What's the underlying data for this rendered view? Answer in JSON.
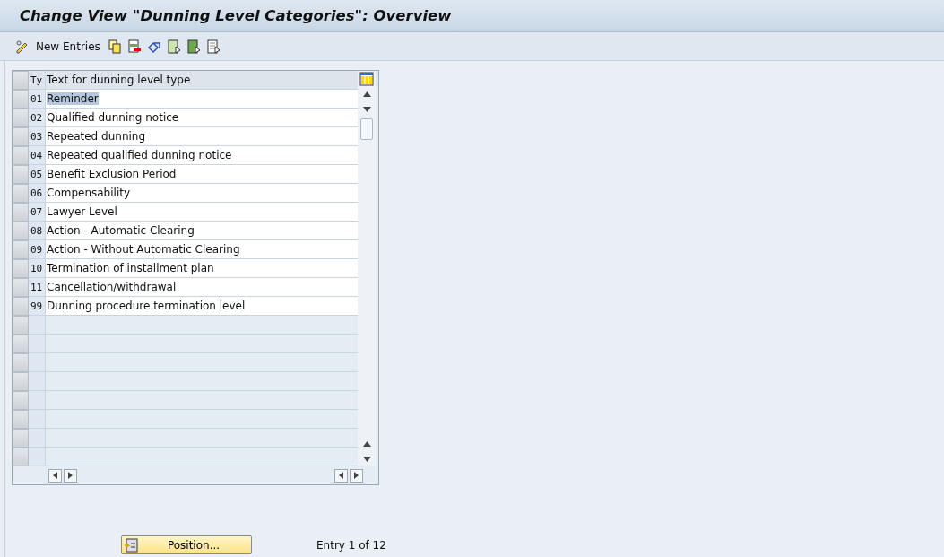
{
  "window": {
    "title": "Change View \"Dunning Level Categories\": Overview"
  },
  "toolbar": {
    "new_entries": "New Entries"
  },
  "table": {
    "columns": [
      "Ty",
      "Text for dunning level type"
    ],
    "rows": [
      {
        "type": "01",
        "text": "Reminder",
        "selected": true
      },
      {
        "type": "02",
        "text": "Qualified dunning notice",
        "selected": false
      },
      {
        "type": "03",
        "text": "Repeated dunning",
        "selected": false
      },
      {
        "type": "04",
        "text": "Repeated qualified dunning notice",
        "selected": false
      },
      {
        "type": "05",
        "text": "Benefit Exclusion Period",
        "selected": false
      },
      {
        "type": "06",
        "text": "Compensability",
        "selected": false
      },
      {
        "type": "07",
        "text": "Lawyer Level",
        "selected": false
      },
      {
        "type": "08",
        "text": "Action - Automatic Clearing",
        "selected": false
      },
      {
        "type": "09",
        "text": "Action - Without Automatic Clearing",
        "selected": false
      },
      {
        "type": "10",
        "text": "Termination of installment plan",
        "selected": false
      },
      {
        "type": "11",
        "text": "Cancellation/withdrawal",
        "selected": false
      },
      {
        "type": "99",
        "text": "Dunning procedure termination level",
        "selected": false
      }
    ]
  },
  "footer": {
    "position_button": "Position...",
    "entry_info": "Entry 1 of 12"
  }
}
